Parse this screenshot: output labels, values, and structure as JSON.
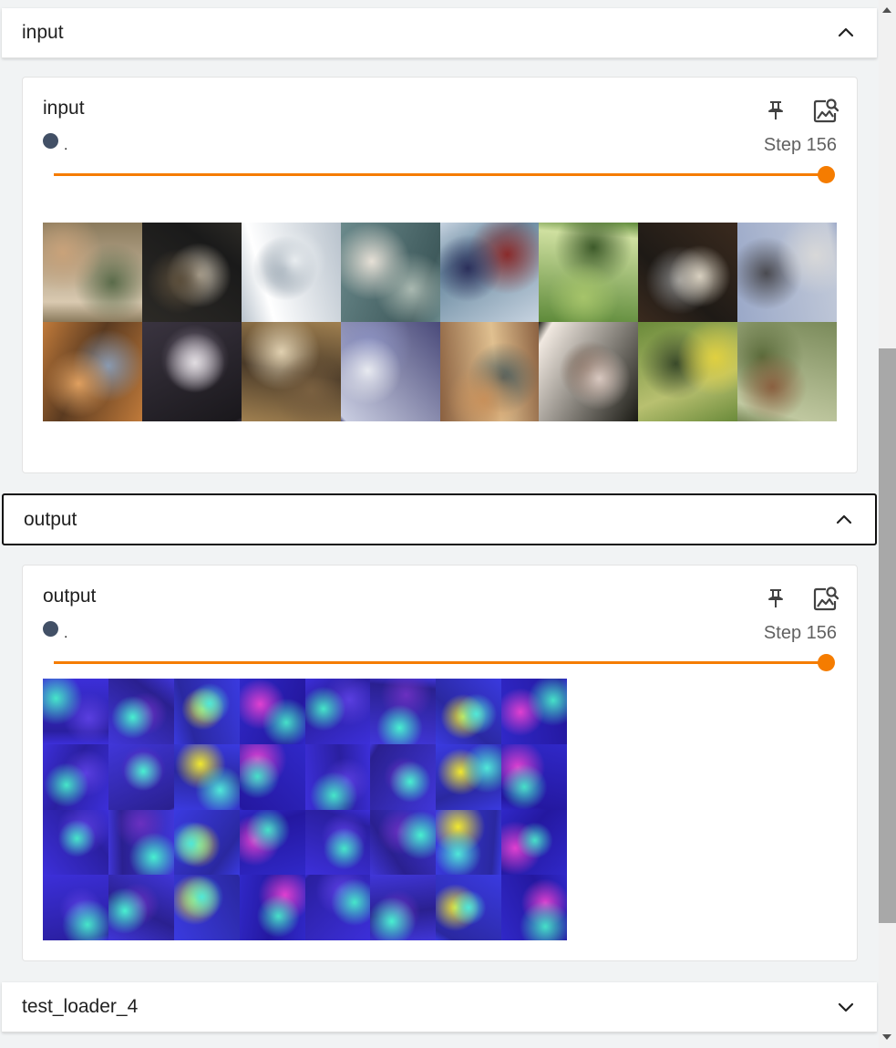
{
  "sections": [
    {
      "header": "input",
      "card": {
        "title": "input",
        "run_label": ".",
        "step_text": "Step 156",
        "step_position": 1.0,
        "image_grid": {
          "cols": 8,
          "rows": 2
        }
      }
    },
    {
      "header": "output",
      "card": {
        "title": "output",
        "run_label": ".",
        "step_text": "Step 156",
        "step_position": 1.0,
        "image_grid": {
          "cols": 8,
          "rows": 4
        }
      }
    },
    {
      "header": "test_loader_4"
    }
  ],
  "colors": {
    "accent": "#f57c00",
    "run_dot": "#425066",
    "step_text": "#616161"
  },
  "icons": [
    "chevron-up-icon",
    "pin-icon",
    "image-search-icon",
    "chevron-down-icon"
  ]
}
